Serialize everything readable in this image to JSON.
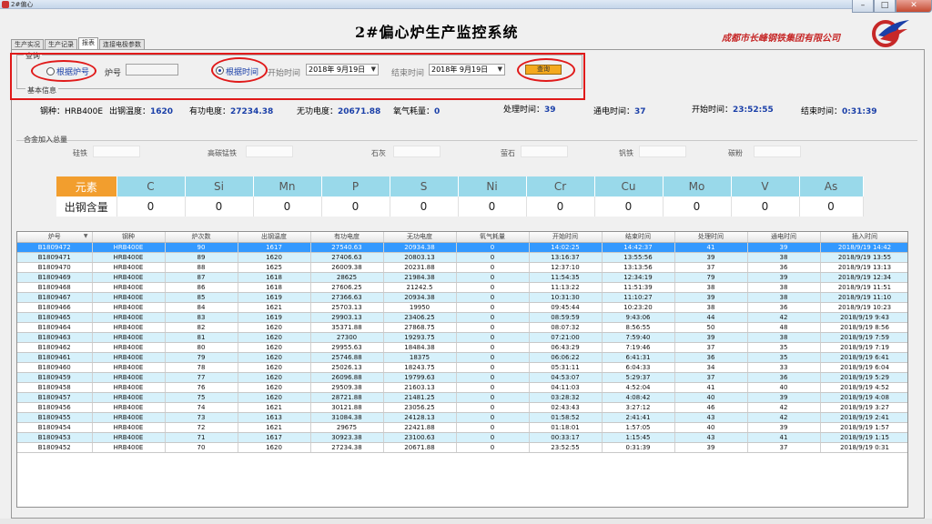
{
  "window": {
    "title": "2#偏心",
    "controls": {
      "minimize": "–",
      "maximize": "□",
      "close": "✕"
    }
  },
  "header": {
    "title": "2#偏心炉生产监控系统",
    "company": "成都市长峰钢铁集团有限公司"
  },
  "tabs": [
    "生产实况",
    "生产记录",
    "报表",
    "连接电极参数"
  ],
  "query": {
    "group_label": "查询",
    "by_furnace_label": "根据炉号",
    "furnace_no_label": "炉号",
    "furnace_no_value": "",
    "by_time_label": "根据时间",
    "start_label": "开始时间",
    "start_value": "2018年 9月19日",
    "end_label": "结束时间",
    "end_value": "2018年 9月19日",
    "query_button": "查询",
    "by_time_selected": true
  },
  "basic_info": {
    "group_label": "基本信息",
    "grade_label": "钢种：",
    "grade_value": "HRB400E",
    "tap_temp_label": "出钢温度：",
    "tap_temp_value": "1620",
    "active_power_label": "有功电度：",
    "active_power_value": "27234.38",
    "reactive_power_label": "无功电度：",
    "reactive_power_value": "20671.88",
    "oxygen_label": "氧气耗量：",
    "oxygen_value": "0",
    "process_time_label": "处理时间：",
    "process_time_value": "39",
    "power_on_label": "通电时间：",
    "power_on_value": "37",
    "start_time_label": "开始时间：",
    "start_time_value": "23:52:55",
    "end_time_label": "结束时间：",
    "end_time_value": "0:31:39"
  },
  "alloy": {
    "group_label": "合金加入总量",
    "items": [
      "硅铁",
      "高碳锰铁",
      "石灰",
      "萤石",
      "钒铁",
      "碳粉"
    ]
  },
  "elements": {
    "header_label": "元素",
    "values_label": "出钢含量",
    "names": [
      "C",
      "Si",
      "Mn",
      "P",
      "S",
      "Ni",
      "Cr",
      "Cu",
      "Mo",
      "V",
      "As"
    ],
    "values": [
      "0",
      "0",
      "0",
      "0",
      "0",
      "0",
      "0",
      "0",
      "0",
      "0",
      "0"
    ]
  },
  "grid": {
    "columns": [
      "炉号",
      "钢种",
      "炉次数",
      "出钢温度",
      "有功电度",
      "无功电度",
      "氧气耗量",
      "开始时间",
      "结束时间",
      "处理时间",
      "通电时间",
      "插入时间"
    ],
    "rows": [
      [
        "B1809472",
        "HRB400E",
        "90",
        "1617",
        "27540.63",
        "20934.38",
        "0",
        "14:02:25",
        "14:42:37",
        "41",
        "39",
        "2018/9/19 14:42"
      ],
      [
        "B1809471",
        "HRB400E",
        "89",
        "1620",
        "27406.63",
        "20803.13",
        "0",
        "13:16:37",
        "13:55:56",
        "39",
        "38",
        "2018/9/19 13:55"
      ],
      [
        "B1809470",
        "HRB400E",
        "88",
        "1625",
        "26009.38",
        "20231.88",
        "0",
        "12:37:10",
        "13:13:56",
        "37",
        "36",
        "2018/9/19 13:13"
      ],
      [
        "B1809469",
        "HRB400E",
        "87",
        "1618",
        "28625",
        "21984.38",
        "0",
        "11:54:35",
        "12:34:19",
        "79",
        "39",
        "2018/9/19 12:34"
      ],
      [
        "B1809468",
        "HRB400E",
        "86",
        "1618",
        "27606.25",
        "21242.5",
        "0",
        "11:13:22",
        "11:51:39",
        "38",
        "38",
        "2018/9/19 11:51"
      ],
      [
        "B1809467",
        "HRB400E",
        "85",
        "1619",
        "27366.63",
        "20934.38",
        "0",
        "10:31:30",
        "11:10:27",
        "39",
        "38",
        "2018/9/19 11:10"
      ],
      [
        "B1809466",
        "HRB400E",
        "84",
        "1621",
        "25703.13",
        "19950",
        "0",
        "09:45:44",
        "10:23:20",
        "38",
        "36",
        "2018/9/19 10:23"
      ],
      [
        "B1809465",
        "HRB400E",
        "83",
        "1619",
        "29903.13",
        "23406.25",
        "0",
        "08:59:59",
        "9:43:06",
        "44",
        "42",
        "2018/9/19 9:43"
      ],
      [
        "B1809464",
        "HRB400E",
        "82",
        "1620",
        "35371.88",
        "27868.75",
        "0",
        "08:07:32",
        "8:56:55",
        "50",
        "48",
        "2018/9/19 8:56"
      ],
      [
        "B1809463",
        "HRB400E",
        "81",
        "1620",
        "27300",
        "19293.75",
        "0",
        "07:21:00",
        "7:59:40",
        "39",
        "38",
        "2018/9/19 7:59"
      ],
      [
        "B1809462",
        "HRB400E",
        "80",
        "1620",
        "29955.63",
        "18484.38",
        "0",
        "06:43:29",
        "7:19:46",
        "37",
        "35",
        "2018/9/19 7:19"
      ],
      [
        "B1809461",
        "HRB400E",
        "79",
        "1620",
        "25746.88",
        "18375",
        "0",
        "06:06:22",
        "6:41:31",
        "36",
        "35",
        "2018/9/19 6:41"
      ],
      [
        "B1809460",
        "HRB400E",
        "78",
        "1620",
        "25026.13",
        "18243.75",
        "0",
        "05:31:11",
        "6:04:33",
        "34",
        "33",
        "2018/9/19 6:04"
      ],
      [
        "B1809459",
        "HRB400E",
        "77",
        "1620",
        "26096.88",
        "19799.63",
        "0",
        "04:53:07",
        "5:29:37",
        "37",
        "36",
        "2018/9/19 5:29"
      ],
      [
        "B1809458",
        "HRB400E",
        "76",
        "1620",
        "29509.38",
        "21603.13",
        "0",
        "04:11:03",
        "4:52:04",
        "41",
        "40",
        "2018/9/19 4:52"
      ],
      [
        "B1809457",
        "HRB400E",
        "75",
        "1620",
        "28721.88",
        "21481.25",
        "0",
        "03:28:32",
        "4:08:42",
        "40",
        "39",
        "2018/9/19 4:08"
      ],
      [
        "B1809456",
        "HRB400E",
        "74",
        "1621",
        "30121.88",
        "23056.25",
        "0",
        "02:43:43",
        "3:27:12",
        "46",
        "42",
        "2018/9/19 3:27"
      ],
      [
        "B1809455",
        "HRB400E",
        "73",
        "1613",
        "31084.38",
        "24128.13",
        "0",
        "01:58:52",
        "2:41:41",
        "43",
        "42",
        "2018/9/19 2:41"
      ],
      [
        "B1809454",
        "HRB400E",
        "72",
        "1621",
        "29675",
        "22421.88",
        "0",
        "01:18:01",
        "1:57:05",
        "40",
        "39",
        "2018/9/19 1:57"
      ],
      [
        "B1809453",
        "HRB400E",
        "71",
        "1617",
        "30923.38",
        "23100.63",
        "0",
        "00:33:17",
        "1:15:45",
        "43",
        "41",
        "2018/9/19 1:15"
      ],
      [
        "B1809452",
        "HRB400E",
        "70",
        "1620",
        "27234.38",
        "20671.88",
        "0",
        "23:52:55",
        "0:31:39",
        "39",
        "37",
        "2018/9/19 0:31"
      ]
    ]
  }
}
